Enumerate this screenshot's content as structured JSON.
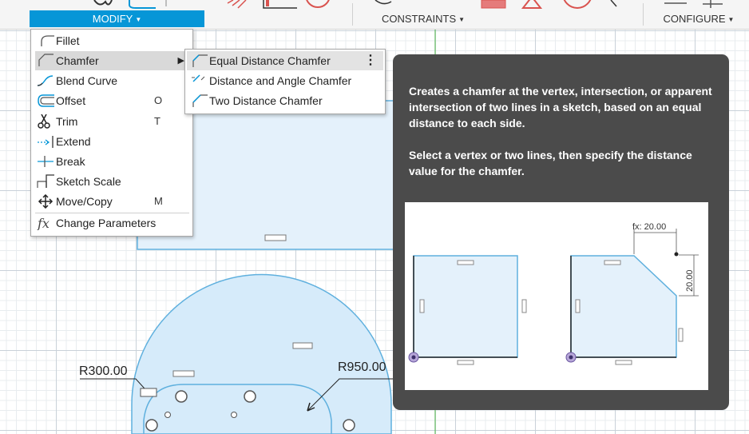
{
  "toolbar": {
    "groups": {
      "modify": "MODIFY",
      "constraints": "CONSTRAINTS",
      "configure": "CONFIGURE"
    },
    "accent_color": "#0696d7"
  },
  "modify_menu": {
    "items": [
      {
        "label": "Fillet",
        "icon": "fillet-icon",
        "shortcut": ""
      },
      {
        "label": "Chamfer",
        "icon": "chamfer-icon",
        "shortcut": ""
      },
      {
        "label": "Blend Curve",
        "icon": "blend-curve-icon",
        "shortcut": ""
      },
      {
        "label": "Offset",
        "icon": "offset-icon",
        "shortcut": "O"
      },
      {
        "label": "Trim",
        "icon": "trim-scissors-icon",
        "shortcut": "T"
      },
      {
        "label": "Extend",
        "icon": "extend-icon",
        "shortcut": ""
      },
      {
        "label": "Break",
        "icon": "break-icon",
        "shortcut": ""
      },
      {
        "label": "Sketch Scale",
        "icon": "sketch-scale-icon",
        "shortcut": ""
      },
      {
        "label": "Move/Copy",
        "icon": "move-copy-icon",
        "shortcut": "M"
      },
      {
        "label": "Change Parameters",
        "icon": "fx-icon",
        "shortcut": ""
      }
    ]
  },
  "chamfer_submenu": {
    "items": [
      {
        "label": "Equal Distance Chamfer",
        "icon": "equal-distance-chamfer-icon"
      },
      {
        "label": "Distance and Angle Chamfer",
        "icon": "distance-angle-chamfer-icon"
      },
      {
        "label": "Two Distance Chamfer",
        "icon": "two-distance-chamfer-icon"
      }
    ]
  },
  "tooltip": {
    "paragraph1": "Creates a chamfer at the vertex, intersection, or apparent intersection of two lines in a sketch, based on an equal distance to each side.",
    "paragraph2": "Select a vertex or two lines, then specify the distance value for the chamfer.",
    "illustration": {
      "dimension_label": "fx: 20.00",
      "vertical_dimension": "20.00"
    }
  },
  "canvas": {
    "dimension_left": "R300.00",
    "dimension_right": "R950.00"
  }
}
